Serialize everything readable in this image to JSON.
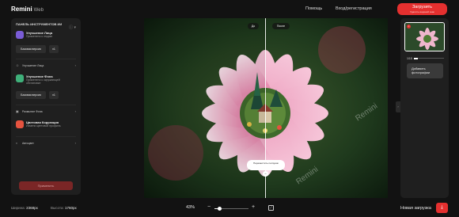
{
  "header": {
    "brand": "Remini",
    "brand_sub": "Web",
    "help": "Помощь",
    "login": "Вход/регистрация",
    "upload_label": "Загрузить",
    "upload_sub": "Удалить водяной знак"
  },
  "left_panel": {
    "title": "ПАНЕЛЬ ИНСТРУМЕНТОВ ИИ",
    "features": [
      {
        "name": "Улучшение Лица",
        "desc": "Применено к людям",
        "icon_color": "#7a5cd6",
        "chips": [
          "Базовая версия",
          "v1"
        ]
      },
      {
        "name": "Улучшение Фона",
        "desc": "Применено к окружающей обстановке",
        "icon_color": "#3fb07a",
        "chips": [
          "Базовая версия",
          "v1"
        ]
      },
      {
        "name": "Цветовая Коррекция",
        "desc": "Измени цветовой профиль",
        "icon_color": "#e5533f",
        "chips": []
      }
    ],
    "rows": [
      {
        "label": "Улучшение Лица"
      },
      {
        "label": "Размытие Фона"
      },
      {
        "label": "Автоцвет"
      }
    ],
    "apply": "Применить"
  },
  "canvas": {
    "before": "До",
    "after": "После",
    "move_label": "Переместить ползунок",
    "watermark": "Remini"
  },
  "right_panel": {
    "count": "1/15",
    "add_photos": "Добавить фотографии"
  },
  "footer": {
    "width_label": "Ширина:",
    "width_value": "2368px",
    "height_label": "Высота:",
    "height_value": "1760px",
    "zoom": "43%",
    "zoom_level": 0.14,
    "new_upload": "Новая загрузка"
  }
}
